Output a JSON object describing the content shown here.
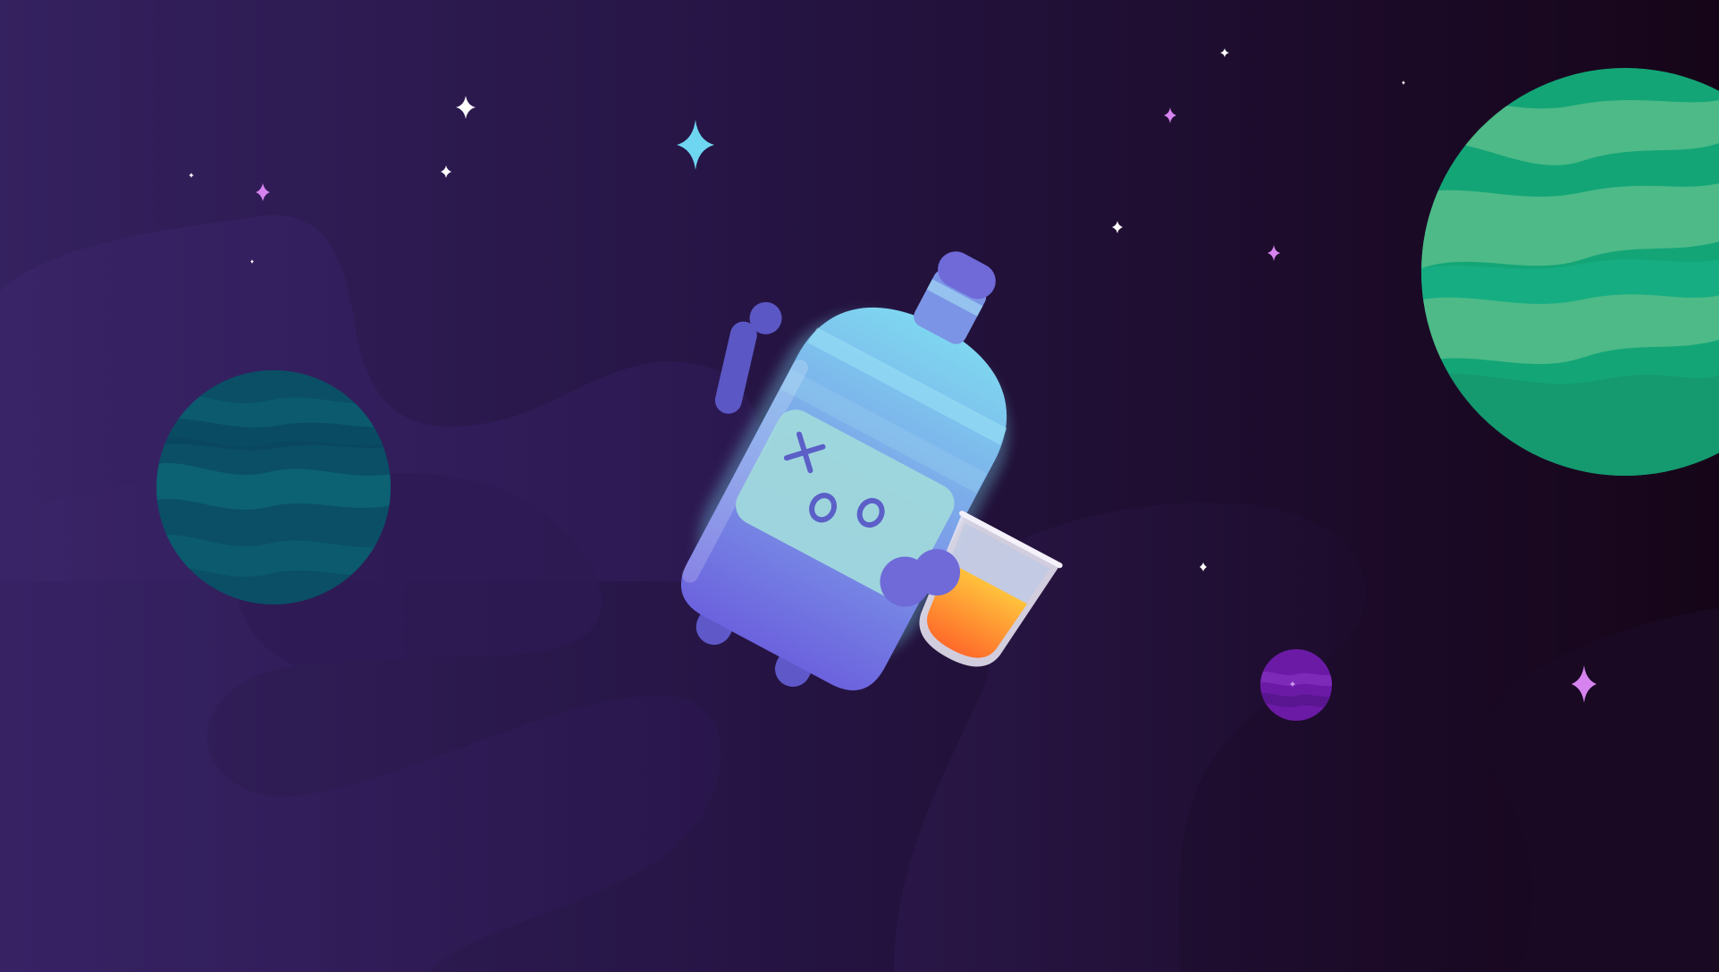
{
  "scene": {
    "description_free": true,
    "colors": {
      "bg_left": "#33205f",
      "bg_mid": "#251540",
      "bg_right": "#150518",
      "nebula_light": "#301c58",
      "nebula_dark": "#22123b",
      "teal_planet": "#0a4e66",
      "teal_planet_band": "#0c5d70",
      "green_planet": "#14a577",
      "green_planet_band": "#4dba87",
      "purple_planet": "#6b1aa6",
      "star_white": "#ffffff",
      "star_pink": "#d683ef",
      "star_cyan": "#6fd6f2",
      "bottle_body": "#7472e2",
      "bottle_glass": "#77d2ee",
      "bottle_label": "#9ed6dc",
      "bottle_face": "#5b5fc7",
      "glass_liquid": "#ff8a2a"
    },
    "icons": [
      "bottle-mascot-icon",
      "whiskey-glass-icon",
      "teal-planet-icon",
      "green-planet-icon",
      "purple-planet-icon",
      "sparkle-star-icon"
    ]
  }
}
